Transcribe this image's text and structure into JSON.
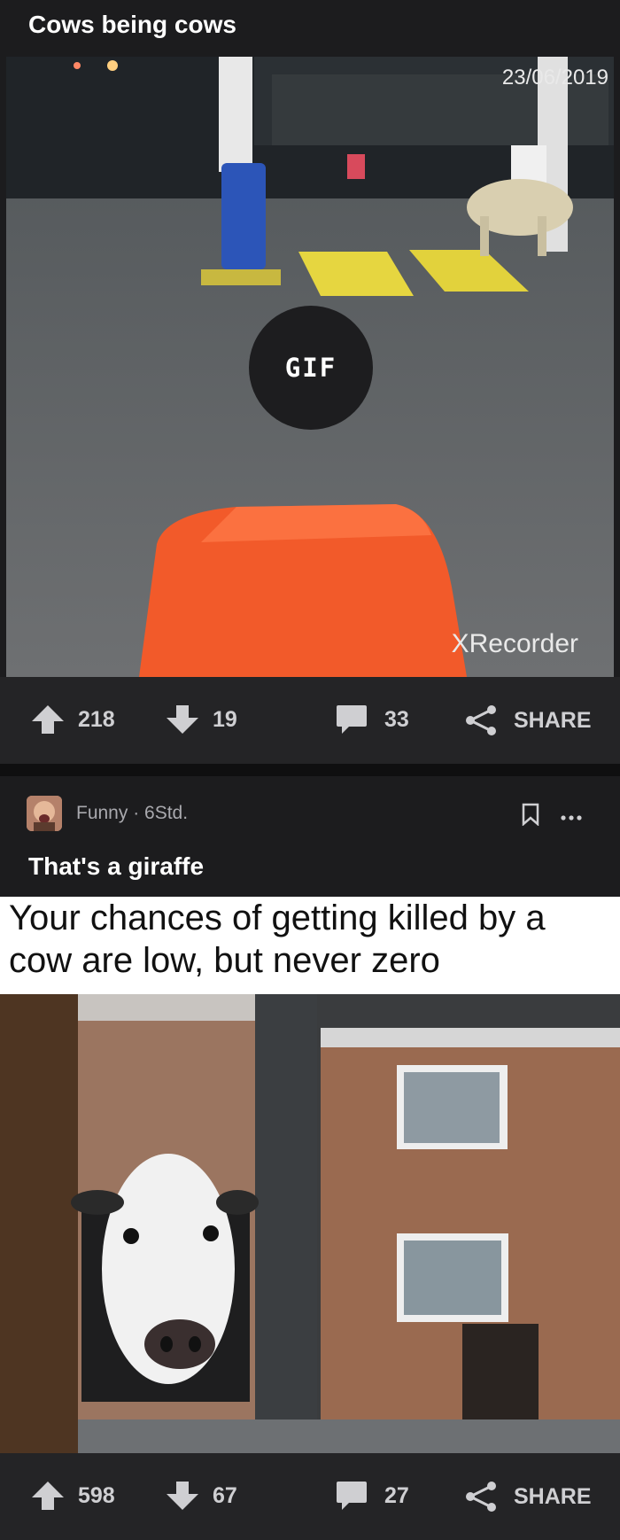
{
  "post1": {
    "title": "Cows being cows",
    "video_timestamp": "23/06/2019",
    "watermark": "XRecorder",
    "gif_badge": "GIF",
    "upvotes": "218",
    "downvotes": "19",
    "comments": "33",
    "share_label": "SHARE"
  },
  "post2": {
    "section_meta": "Funny · 6Std.",
    "title": "That's a giraffe",
    "meme_caption": "Your chances of getting killed by a cow are low, but never zero",
    "upvotes": "598",
    "downvotes": "67",
    "comments": "27",
    "share_label": "SHARE"
  },
  "icons": {
    "upvote": "arrow-up-icon",
    "downvote": "arrow-down-icon",
    "comment": "comment-bubble-icon",
    "share": "share-icon",
    "save": "bookmark-icon",
    "more": "more-dots-icon"
  },
  "colors": {
    "background": "#1c1c1e",
    "action_bar": "#242426",
    "text": "#ffffff",
    "muted": "#cfcfd2"
  }
}
